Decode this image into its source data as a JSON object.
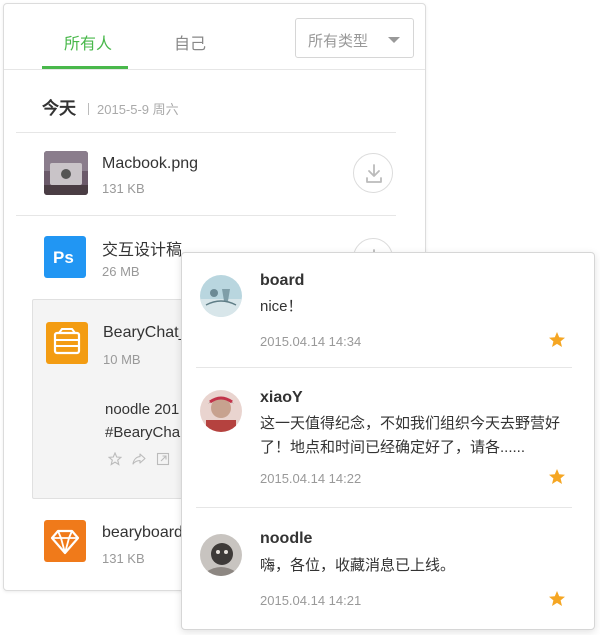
{
  "tabs": {
    "everyone": "所有人",
    "self": "自己",
    "type_filter": "所有类型"
  },
  "day": {
    "title": "今天",
    "date": "2015-5-9 周六"
  },
  "files": [
    {
      "name": "Macbook.png",
      "size": "131 KB",
      "icon": "image-thumbnail"
    },
    {
      "name": "交互设计稿",
      "size": "26 MB",
      "icon": "photoshop-icon",
      "badge": "Ps"
    },
    {
      "name": "BearyChat_",
      "size": "10 MB",
      "icon": "archive-icon"
    },
    {
      "name": "bearyboard",
      "size": "131 KB",
      "icon": "sketch-icon"
    }
  ],
  "message": {
    "line1": "noodle 201",
    "line2": "#BearyCha"
  },
  "comments": [
    {
      "user": "board",
      "text": "nice！",
      "time": "2015.04.14 14:34"
    },
    {
      "user": "xiaoY",
      "text": "这一天值得纪念，不如我们组织今天去野营好了！地点和时间已经确定好了，请各......",
      "time": "2015.04.14 14:22"
    },
    {
      "user": "noodle",
      "text": "嗨，各位，收藏消息已上线。",
      "time": "2015.04.14 14:21"
    }
  ],
  "colors": {
    "accent": "#49b84b",
    "star": "#f5a623",
    "photoshop": "#2196f3",
    "archive": "#f39c12",
    "sketch": "#f07a1a"
  }
}
